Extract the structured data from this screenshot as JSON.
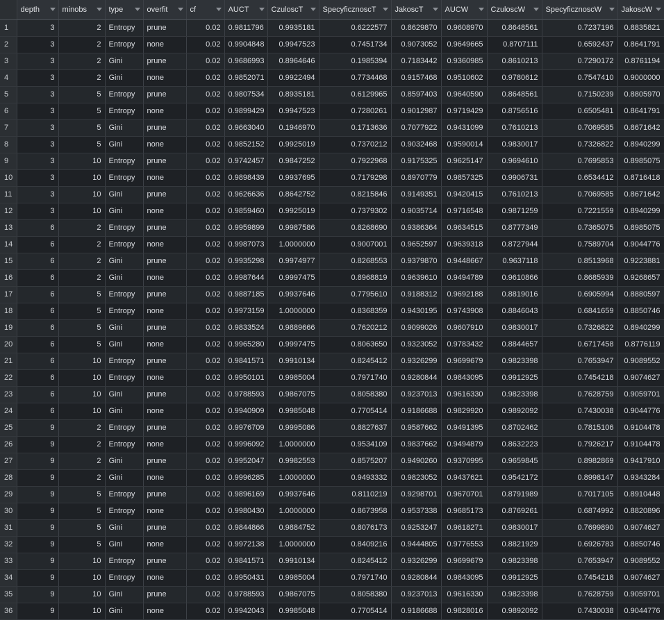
{
  "columns": [
    "depth",
    "minobs",
    "type",
    "overfit",
    "cf",
    "AUCT",
    "CzuloscT",
    "SpecyficznoscT",
    "JakoscT",
    "AUCW",
    "CzuloscW",
    "SpecyficznoscW",
    "JakoscW"
  ],
  "rows": [
    [
      "1",
      "3",
      "2",
      "Entropy",
      "prune",
      "0.02",
      "0.9811796",
      "0.9935181",
      "0.6222577",
      "0.8629870",
      "0.9608970",
      "0.8648561",
      "0.7237196",
      "0.8835821"
    ],
    [
      "2",
      "3",
      "2",
      "Entropy",
      "none",
      "0.02",
      "0.9904848",
      "0.9947523",
      "0.7451734",
      "0.9073052",
      "0.9649665",
      "0.8707111",
      "0.6592437",
      "0.8641791"
    ],
    [
      "3",
      "3",
      "2",
      "Gini",
      "prune",
      "0.02",
      "0.9686993",
      "0.8964646",
      "0.1985394",
      "0.7183442",
      "0.9360985",
      "0.8610213",
      "0.7290172",
      "0.8761194"
    ],
    [
      "4",
      "3",
      "2",
      "Gini",
      "none",
      "0.02",
      "0.9852071",
      "0.9922494",
      "0.7734468",
      "0.9157468",
      "0.9510602",
      "0.9780612",
      "0.7547410",
      "0.9000000"
    ],
    [
      "5",
      "3",
      "5",
      "Entropy",
      "prune",
      "0.02",
      "0.9807534",
      "0.8935181",
      "0.6129965",
      "0.8597403",
      "0.9640590",
      "0.8648561",
      "0.7150239",
      "0.8805970"
    ],
    [
      "6",
      "3",
      "5",
      "Entropy",
      "none",
      "0.02",
      "0.9899429",
      "0.9947523",
      "0.7280261",
      "0.9012987",
      "0.9719429",
      "0.8756516",
      "0.6505481",
      "0.8641791"
    ],
    [
      "7",
      "3",
      "5",
      "Gini",
      "prune",
      "0.02",
      "0.9663040",
      "0.1946970",
      "0.1713636",
      "0.7077922",
      "0.9431099",
      "0.7610213",
      "0.7069585",
      "0.8671642"
    ],
    [
      "8",
      "3",
      "5",
      "Gini",
      "none",
      "0.02",
      "0.9852152",
      "0.9925019",
      "0.7370212",
      "0.9032468",
      "0.9590014",
      "0.9830017",
      "0.7326822",
      "0.8940299"
    ],
    [
      "9",
      "3",
      "10",
      "Entropy",
      "prune",
      "0.02",
      "0.9742457",
      "0.9847252",
      "0.7922968",
      "0.9175325",
      "0.9625147",
      "0.9694610",
      "0.7695853",
      "0.8985075"
    ],
    [
      "10",
      "3",
      "10",
      "Entropy",
      "none",
      "0.02",
      "0.9898439",
      "0.9937695",
      "0.7179298",
      "0.8970779",
      "0.9857325",
      "0.9906731",
      "0.6534412",
      "0.8716418"
    ],
    [
      "11",
      "3",
      "10",
      "Gini",
      "prune",
      "0.02",
      "0.9626636",
      "0.8642752",
      "0.8215846",
      "0.9149351",
      "0.9420415",
      "0.7610213",
      "0.7069585",
      "0.8671642"
    ],
    [
      "12",
      "3",
      "10",
      "Gini",
      "none",
      "0.02",
      "0.9859460",
      "0.9925019",
      "0.7379302",
      "0.9035714",
      "0.9716548",
      "0.9871259",
      "0.7221559",
      "0.8940299"
    ],
    [
      "13",
      "6",
      "2",
      "Entropy",
      "prune",
      "0.02",
      "0.9959899",
      "0.9987586",
      "0.8268690",
      "0.9386364",
      "0.9634515",
      "0.8777349",
      "0.7365075",
      "0.8985075"
    ],
    [
      "14",
      "6",
      "2",
      "Entropy",
      "none",
      "0.02",
      "0.9987073",
      "1.0000000",
      "0.9007001",
      "0.9652597",
      "0.9639318",
      "0.8727944",
      "0.7589704",
      "0.9044776"
    ],
    [
      "15",
      "6",
      "2",
      "Gini",
      "prune",
      "0.02",
      "0.9935298",
      "0.9974977",
      "0.8268553",
      "0.9379870",
      "0.9448667",
      "0.9637118",
      "0.8513968",
      "0.9223881"
    ],
    [
      "16",
      "6",
      "2",
      "Gini",
      "none",
      "0.02",
      "0.9987644",
      "0.9997475",
      "0.8968819",
      "0.9639610",
      "0.9494789",
      "0.9610866",
      "0.8685939",
      "0.9268657"
    ],
    [
      "17",
      "6",
      "5",
      "Entropy",
      "prune",
      "0.02",
      "0.9887185",
      "0.9937646",
      "0.7795610",
      "0.9188312",
      "0.9692188",
      "0.8819016",
      "0.6905994",
      "0.8880597"
    ],
    [
      "18",
      "6",
      "5",
      "Entropy",
      "none",
      "0.02",
      "0.9973159",
      "1.0000000",
      "0.8368359",
      "0.9430195",
      "0.9743908",
      "0.8846043",
      "0.6841659",
      "0.8850746"
    ],
    [
      "19",
      "6",
      "5",
      "Gini",
      "prune",
      "0.02",
      "0.9833524",
      "0.9889666",
      "0.7620212",
      "0.9099026",
      "0.9607910",
      "0.9830017",
      "0.7326822",
      "0.8940299"
    ],
    [
      "20",
      "6",
      "5",
      "Gini",
      "none",
      "0.02",
      "0.9965280",
      "0.9997475",
      "0.8063650",
      "0.9323052",
      "0.9783432",
      "0.8844657",
      "0.6717458",
      "0.8776119"
    ],
    [
      "21",
      "6",
      "10",
      "Entropy",
      "prune",
      "0.02",
      "0.9841571",
      "0.9910134",
      "0.8245412",
      "0.9326299",
      "0.9699679",
      "0.9823398",
      "0.7653947",
      "0.9089552"
    ],
    [
      "22",
      "6",
      "10",
      "Entropy",
      "none",
      "0.02",
      "0.9950101",
      "0.9985004",
      "0.7971740",
      "0.9280844",
      "0.9843095",
      "0.9912925",
      "0.7454218",
      "0.9074627"
    ],
    [
      "23",
      "6",
      "10",
      "Gini",
      "prune",
      "0.02",
      "0.9788593",
      "0.9867075",
      "0.8058380",
      "0.9237013",
      "0.9616330",
      "0.9823398",
      "0.7628759",
      "0.9059701"
    ],
    [
      "24",
      "6",
      "10",
      "Gini",
      "none",
      "0.02",
      "0.9940909",
      "0.9985048",
      "0.7705414",
      "0.9186688",
      "0.9829920",
      "0.9892092",
      "0.7430038",
      "0.9044776"
    ],
    [
      "25",
      "9",
      "2",
      "Entropy",
      "prune",
      "0.02",
      "0.9976709",
      "0.9995086",
      "0.8827637",
      "0.9587662",
      "0.9491395",
      "0.8702462",
      "0.7815106",
      "0.9104478"
    ],
    [
      "26",
      "9",
      "2",
      "Entropy",
      "none",
      "0.02",
      "0.9996092",
      "1.0000000",
      "0.9534109",
      "0.9837662",
      "0.9494879",
      "0.8632223",
      "0.7926217",
      "0.9104478"
    ],
    [
      "27",
      "9",
      "2",
      "Gini",
      "prune",
      "0.02",
      "0.9952047",
      "0.9982553",
      "0.8575207",
      "0.9490260",
      "0.9370995",
      "0.9659845",
      "0.8982869",
      "0.9417910"
    ],
    [
      "28",
      "9",
      "2",
      "Gini",
      "none",
      "0.02",
      "0.9996285",
      "1.0000000",
      "0.9493332",
      "0.9823052",
      "0.9437621",
      "0.9542172",
      "0.8998147",
      "0.9343284"
    ],
    [
      "29",
      "9",
      "5",
      "Entropy",
      "prune",
      "0.02",
      "0.9896169",
      "0.9937646",
      "0.8110219",
      "0.9298701",
      "0.9670701",
      "0.8791989",
      "0.7017105",
      "0.8910448"
    ],
    [
      "30",
      "9",
      "5",
      "Entropy",
      "none",
      "0.02",
      "0.9980430",
      "1.0000000",
      "0.8673958",
      "0.9537338",
      "0.9685173",
      "0.8769261",
      "0.6874992",
      "0.8820896"
    ],
    [
      "31",
      "9",
      "5",
      "Gini",
      "prune",
      "0.02",
      "0.9844866",
      "0.9884752",
      "0.8076173",
      "0.9253247",
      "0.9618271",
      "0.9830017",
      "0.7699890",
      "0.9074627"
    ],
    [
      "32",
      "9",
      "5",
      "Gini",
      "none",
      "0.02",
      "0.9972138",
      "1.0000000",
      "0.8409216",
      "0.9444805",
      "0.9776553",
      "0.8821929",
      "0.6926783",
      "0.8850746"
    ],
    [
      "33",
      "9",
      "10",
      "Entropy",
      "prune",
      "0.02",
      "0.9841571",
      "0.9910134",
      "0.8245412",
      "0.9326299",
      "0.9699679",
      "0.9823398",
      "0.7653947",
      "0.9089552"
    ],
    [
      "34",
      "9",
      "10",
      "Entropy",
      "none",
      "0.02",
      "0.9950431",
      "0.9985004",
      "0.7971740",
      "0.9280844",
      "0.9843095",
      "0.9912925",
      "0.7454218",
      "0.9074627"
    ],
    [
      "35",
      "9",
      "10",
      "Gini",
      "prune",
      "0.02",
      "0.9788593",
      "0.9867075",
      "0.8058380",
      "0.9237013",
      "0.9616330",
      "0.9823398",
      "0.7628759",
      "0.9059701"
    ],
    [
      "36",
      "9",
      "10",
      "Gini",
      "none",
      "0.02",
      "0.9942043",
      "0.9985048",
      "0.7705414",
      "0.9186688",
      "0.9828016",
      "0.9892092",
      "0.7430038",
      "0.9044776"
    ]
  ]
}
